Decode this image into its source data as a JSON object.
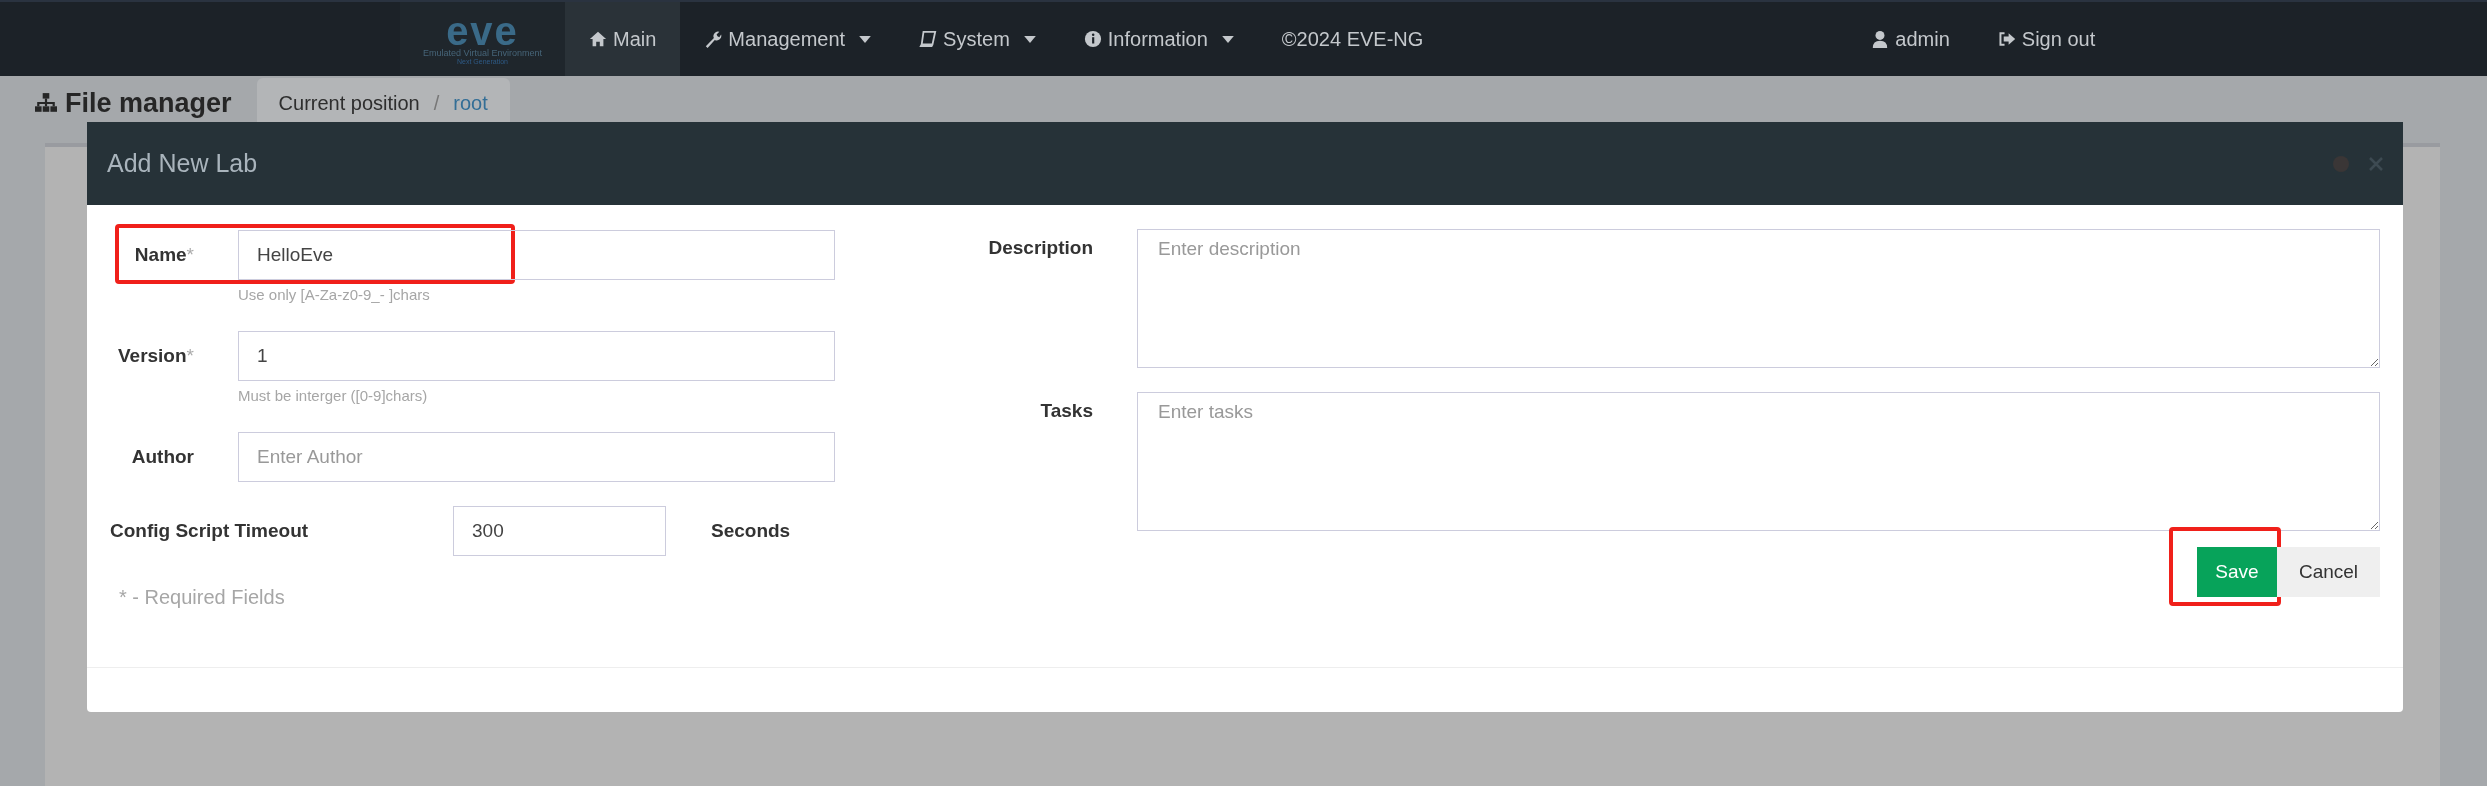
{
  "navbar": {
    "logo": {
      "wordmark": "eve",
      "tagline": "Emulated Virtual Environment",
      "subline": "Next Generation"
    },
    "items": [
      {
        "label": "Main",
        "dropdown": false,
        "selected": true
      },
      {
        "label": "Management",
        "dropdown": true,
        "selected": false
      },
      {
        "label": "System",
        "dropdown": true,
        "selected": false
      },
      {
        "label": "Information",
        "dropdown": true,
        "selected": false
      },
      {
        "label": "©2024 EVE-NG",
        "dropdown": false,
        "selected": false
      }
    ],
    "user": {
      "label": "admin"
    },
    "signout": {
      "label": "Sign out"
    }
  },
  "page": {
    "title": "File manager",
    "breadcrumb": {
      "label": "Current position",
      "separator": "/",
      "current": "root"
    }
  },
  "dialog": {
    "title": "Add New Lab",
    "fields": [
      {
        "label": "Name",
        "required": "*",
        "value": "HelloEve",
        "hint": "Use only [A-Za-z0-9_- ]chars",
        "highlighted": true
      },
      {
        "label": "Version",
        "required": "*",
        "value": "1",
        "hint": "Must be interger ([0-9]chars)",
        "highlighted": false
      },
      {
        "label": "Author",
        "placeholder": "Enter Author",
        "highlighted": false
      }
    ],
    "timeout": {
      "label": "Config Script Timeout",
      "value": "300",
      "unit": "Seconds"
    },
    "required_note": "* - Required Fields",
    "textareas": [
      {
        "label": "Description",
        "placeholder": "Enter description"
      },
      {
        "label": "Tasks",
        "placeholder": "Enter tasks"
      }
    ],
    "buttons": [
      {
        "label": "Save",
        "kind": "primary",
        "highlighted": true
      },
      {
        "label": "Cancel",
        "kind": "default",
        "highlighted": false
      }
    ]
  }
}
